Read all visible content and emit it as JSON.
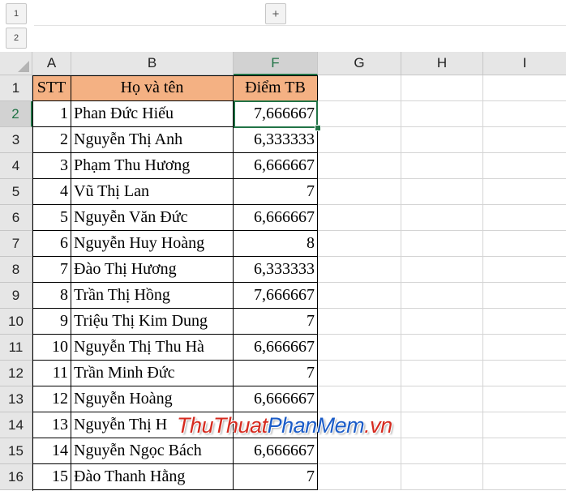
{
  "outline": {
    "level_buttons": [
      "1",
      "2"
    ],
    "expand_button": "+"
  },
  "columns": [
    "A",
    "B",
    "F",
    "G",
    "H",
    "I"
  ],
  "rows": [
    "1",
    "2",
    "3",
    "4",
    "5",
    "6",
    "7",
    "8",
    "9",
    "10",
    "11",
    "12",
    "13",
    "14",
    "15",
    "16"
  ],
  "selected": {
    "column": "F",
    "row": "2",
    "cell": "F2"
  },
  "table": {
    "headers": [
      "STT",
      "Họ và tên",
      "Điểm TB"
    ],
    "data": [
      [
        "1",
        "Phan Đức Hiếu",
        "7,666667"
      ],
      [
        "2",
        "Nguyễn Thị Anh",
        "6,333333"
      ],
      [
        "3",
        "Phạm Thu Hương",
        "6,666667"
      ],
      [
        "4",
        "Vũ Thị Lan",
        "7"
      ],
      [
        "5",
        "Nguyễn Văn Đức",
        "6,666667"
      ],
      [
        "6",
        "Nguyễn Huy Hoàng",
        "8"
      ],
      [
        "7",
        "Đào Thị Hương",
        "6,333333"
      ],
      [
        "8",
        "Trần Thị Hồng",
        "7,666667"
      ],
      [
        "9",
        "Triệu Thị Kim Dung",
        "7"
      ],
      [
        "10",
        "Nguyễn Thị Thu Hà",
        "6,666667"
      ],
      [
        "11",
        "Trần Minh Đức",
        "7"
      ],
      [
        "12",
        "Nguyễn Hoàng",
        "6,666667"
      ],
      [
        "13",
        "Nguyễn Thị H",
        ""
      ],
      [
        "14",
        "Nguyễn Ngọc Bách",
        "6,666667"
      ],
      [
        "15",
        "Đào Thanh Hằng",
        "7"
      ]
    ]
  },
  "watermark": {
    "part1": "ThuThuat",
    "part2": "PhanMem",
    "part3": ".vn"
  },
  "colors": {
    "header_fill": "#f4b183",
    "selection_accent": "#217346",
    "watermark_red": "#d62a1f",
    "watermark_blue": "#1b5cc8"
  }
}
